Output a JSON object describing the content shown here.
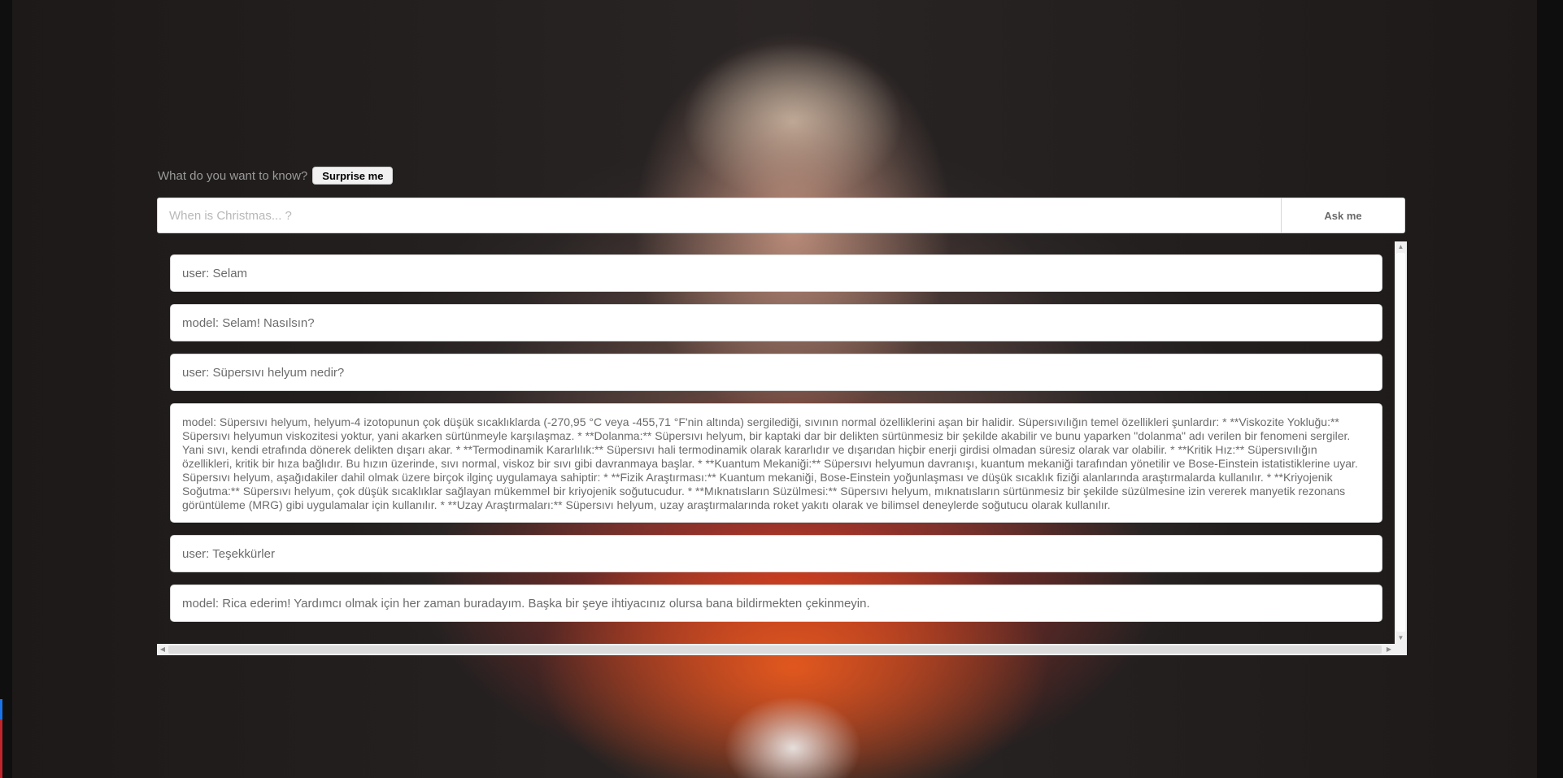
{
  "prompt": {
    "label": "What do you want to know?",
    "surprise_label": "Surprise me"
  },
  "ask": {
    "placeholder": "When is Christmas... ?",
    "value": "",
    "button_label": "Ask me"
  },
  "chat": {
    "messages": [
      {
        "text": "user: Selam"
      },
      {
        "text": "model: Selam! Nasılsın?"
      },
      {
        "text": "user: Süpersıvı helyum nedir?"
      },
      {
        "text": "model: Süpersıvı helyum, helyum-4 izotopunun çok düşük sıcaklıklarda (-270,95 °C veya -455,71 °F'nin altında) sergilediği, sıvının normal özelliklerini aşan bir halidir. Süpersıvılığın temel özellikleri şunlardır: * **Viskozite Yokluğu:** Süpersıvı helyumun viskozitesi yoktur, yani akarken sürtünmeyle karşılaşmaz. * **Dolanma:** Süpersıvı helyum, bir kaptaki dar bir delikten sürtünmesiz bir şekilde akabilir ve bunu yaparken \"dolanma\" adı verilen bir fenomeni sergiler. Yani sıvı, kendi etrafında dönerek delikten dışarı akar. * **Termodinamik Kararlılık:** Süpersıvı hali termodinamik olarak kararlıdır ve dışarıdan hiçbir enerji girdisi olmadan süresiz olarak var olabilir. * **Kritik Hız:** Süpersıvılığın özellikleri, kritik bir hıza bağlıdır. Bu hızın üzerinde, sıvı normal, viskoz bir sıvı gibi davranmaya başlar. * **Kuantum Mekaniği:** Süpersıvı helyumun davranışı, kuantum mekaniği tarafından yönetilir ve Bose-Einstein istatistiklerine uyar. Süpersıvı helyum, aşağıdakiler dahil olmak üzere birçok ilginç uygulamaya sahiptir: * **Fizik Araştırması:** Kuantum mekaniği, Bose-Einstein yoğunlaşması ve düşük sıcaklık fiziği alanlarında araştırmalarda kullanılır. * **Kriyojenik Soğutma:** Süpersıvı helyum, çok düşük sıcaklıklar sağlayan mükemmel bir kriyojenik soğutucudur. * **Mıknatısların Süzülmesi:** Süpersıvı helyum, mıknatısların sürtünmesiz bir şekilde süzülmesine izin vererek manyetik rezonans görüntüleme (MRG) gibi uygulamalar için kullanılır. * **Uzay Araştırmaları:** Süpersıvı helyum, uzay araştırmalarında roket yakıtı olarak ve bilimsel deneylerde soğutucu olarak kullanılır.",
        "long": true
      },
      {
        "text": "user: Teşekkürler"
      },
      {
        "text": "model: Rica ederim! Yardımcı olmak için her zaman buradayım. Başka bir şeye ihtiyacınız olursa bana bildirmekten çekinmeyin."
      }
    ]
  }
}
